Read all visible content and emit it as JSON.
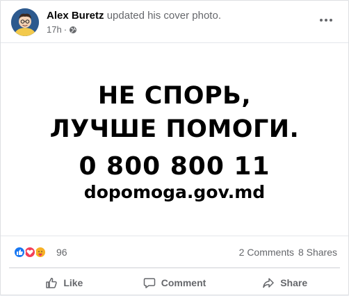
{
  "post": {
    "author_name": "Alex Buretz",
    "action_text": "updated his cover photo.",
    "time": "17h",
    "privacy_icon": "globe-icon",
    "more_icon": "more-options-icon"
  },
  "cover": {
    "line1": "НЕ СПОРЬ,",
    "line2": "ЛУЧШЕ ПОМОГИ.",
    "phone": "0 800 800 11",
    "website": "dopomoga.gov.md",
    "text_color": "#000000",
    "background": "#ffffff"
  },
  "stats": {
    "reaction_icons": [
      "like-icon",
      "love-icon",
      "care-icon"
    ],
    "reaction_count": "96",
    "comments": "2 Comments",
    "shares": "8 Shares"
  },
  "actions": {
    "like_label": "Like",
    "comment_label": "Comment",
    "share_label": "Share"
  },
  "colors": {
    "like_blue": "#1877f2",
    "love_red": "#f33e58",
    "care_yellow": "#f7b125",
    "secondary_text": "#65676b"
  }
}
